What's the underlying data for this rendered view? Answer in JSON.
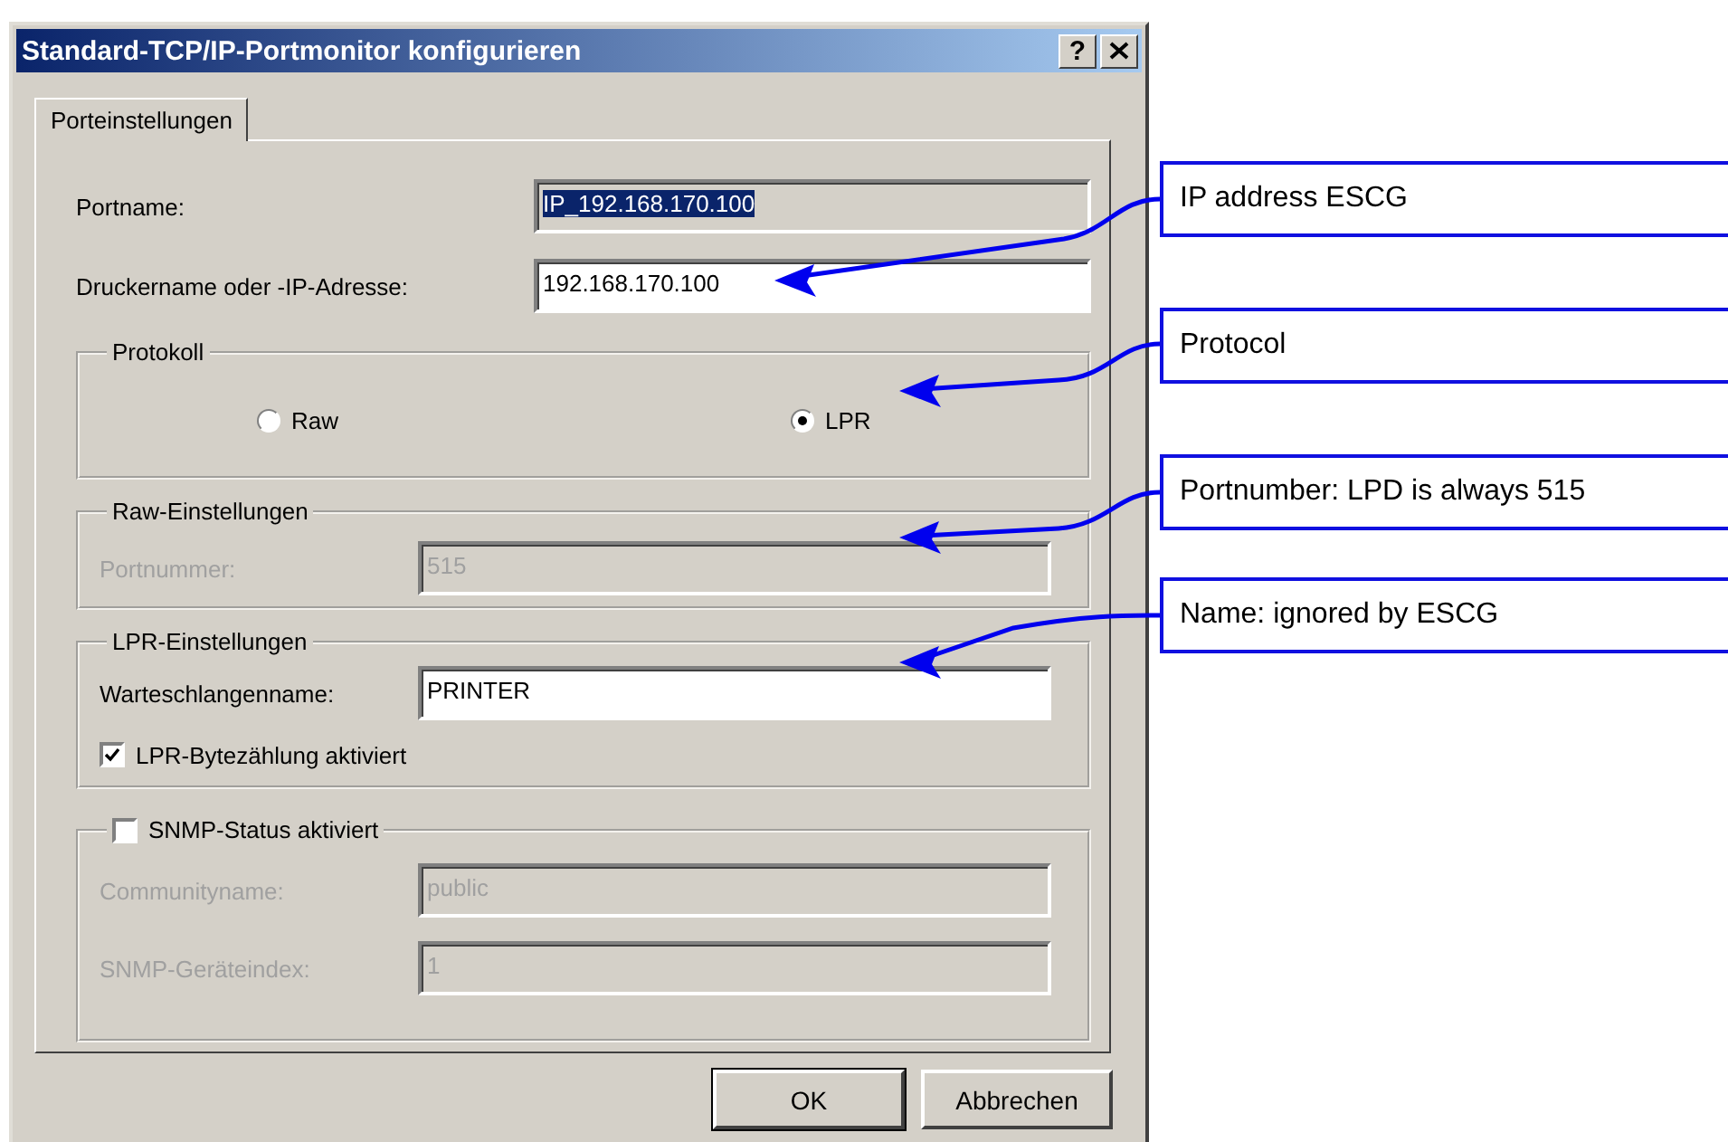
{
  "window": {
    "title": "Standard-TCP/IP-Portmonitor konfigurieren",
    "help": "?"
  },
  "tabs": [
    {
      "label": "Porteinstellungen",
      "selected": true
    }
  ],
  "fields": [
    {
      "label": "Portname:",
      "value": "IP_192.168.170.100",
      "disabled": true,
      "highlighted": true
    },
    {
      "label": "Druckername oder -IP-Adresse:",
      "value": "192.168.170.100",
      "disabled": false,
      "highlighted": false
    }
  ],
  "protocol": {
    "title": "Protokoll",
    "options": [
      {
        "label": "Raw",
        "selected": false
      },
      {
        "label": "LPR",
        "selected": true
      }
    ]
  },
  "raw_settings": {
    "title": "Raw-Einstellungen",
    "disabled": true,
    "fields": [
      {
        "label": "Portnummer:",
        "value": "515"
      }
    ]
  },
  "lpr_settings": {
    "title": "LPR-Einstellungen",
    "disabled": false,
    "fields": [
      {
        "label": "Warteschlangenname:",
        "value": "PRINTER"
      }
    ],
    "checkbox": {
      "label": "LPR-Bytezählung aktiviert",
      "checked": true
    }
  },
  "snmp_settings": {
    "title": "SNMP-Status aktiviert",
    "checked": false,
    "disabled": true,
    "fields": [
      {
        "label": "Communityname:",
        "value": "public"
      },
      {
        "label": "SNMP-Geräteindex:",
        "value": "1"
      }
    ]
  },
  "buttons": [
    "OK",
    "Abbrechen"
  ],
  "annotations": [
    {
      "text": "IP address ESCG"
    },
    {
      "text": "Protocol"
    },
    {
      "text": "Portnumber: LPD is always 515"
    },
    {
      "text": "Name: ignored by ESCG"
    }
  ]
}
